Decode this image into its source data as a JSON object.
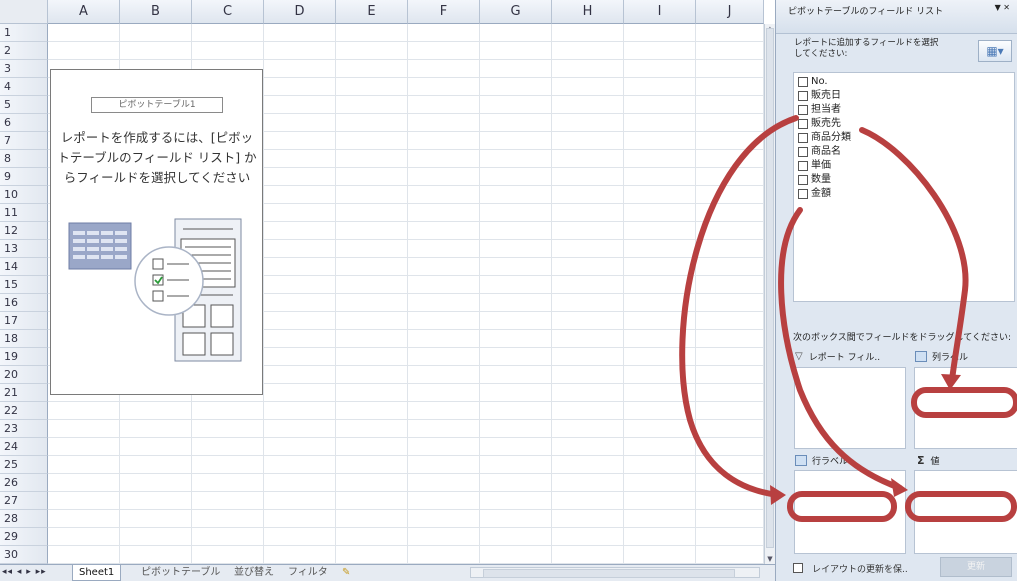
{
  "spreadsheet": {
    "columns": [
      "A",
      "B",
      "C",
      "D",
      "E",
      "F",
      "G",
      "H",
      "I",
      "J"
    ],
    "rows": [
      "1",
      "2",
      "3",
      "4",
      "5",
      "6",
      "7",
      "8",
      "9",
      "10",
      "11",
      "12",
      "13",
      "14",
      "15",
      "16",
      "17",
      "18",
      "19",
      "20",
      "21",
      "22",
      "23",
      "24",
      "25",
      "26",
      "27",
      "28",
      "29",
      "30"
    ]
  },
  "pivot_placeholder": {
    "name": "ピボットテーブル1",
    "message": "レポートを作成するには、[ピボッ\nトテーブルのフィールド リスト] か\nらフィールドを選択してください"
  },
  "sheet_tabs": {
    "nav": "◂◂ ◂ ▸ ▸▸",
    "tabs": [
      "Sheet1",
      "ピボットテーブル",
      "並び替え",
      "フィルタ"
    ]
  },
  "field_list_panel": {
    "title": "ピボットテーブルのフィールド リスト",
    "dropdown_icon": "chevron-down-icon",
    "instruction": "レポートに追加するフィールドを選択\nしてください:",
    "fields": [
      "No.",
      "販売日",
      "担当者",
      "販売先",
      "商品分類",
      "商品名",
      "単価",
      "数量",
      "金額"
    ],
    "drop_instruction": "次のボックス間でフィールドをドラッグしてください:",
    "zones": {
      "report_filter": "レポート フィル..",
      "column_labels": "列ラベル",
      "row_labels": "行ラベル",
      "values": "値"
    },
    "defer_layout_label": "レイアウトの更新を保..",
    "update_button": "更新"
  },
  "colors": {
    "arrow": "#b84040",
    "panel_bg": "#dfe7f1",
    "header_bg": "#e2e8f0"
  }
}
